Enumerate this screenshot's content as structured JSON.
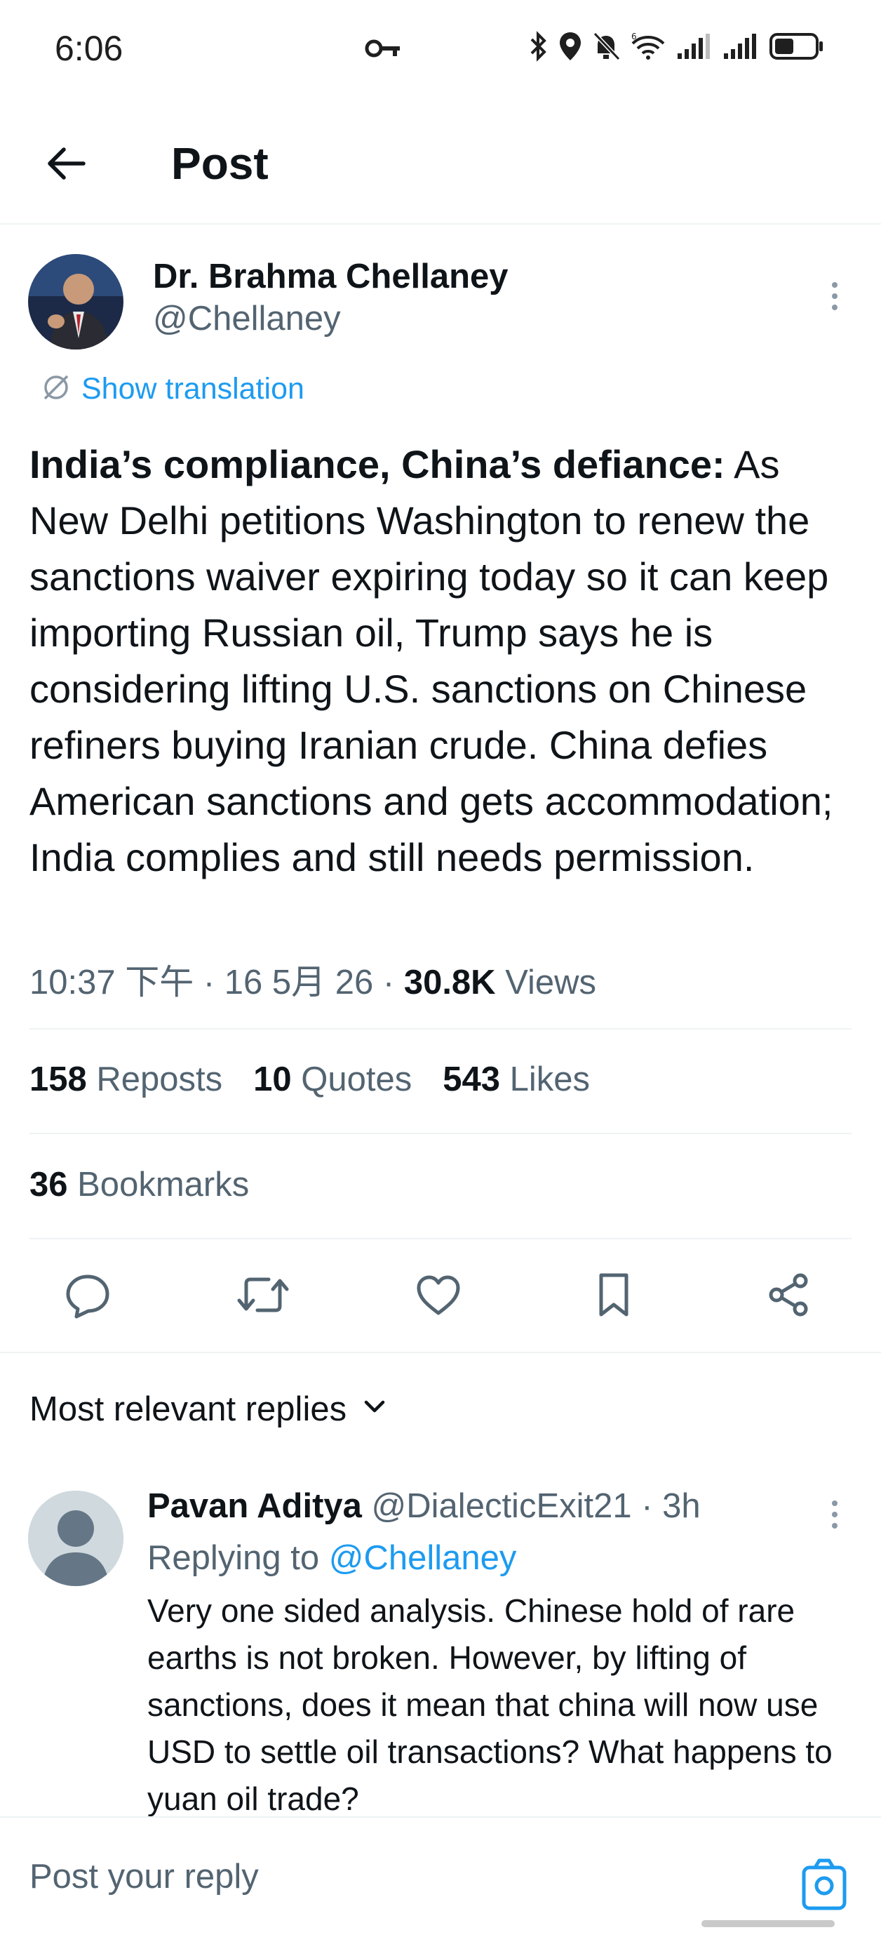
{
  "status_bar": {
    "time": "6:06",
    "icons": [
      "key-icon",
      "bluetooth-icon",
      "location-icon",
      "bell-off-icon",
      "wifi-6-icon",
      "signal-icon",
      "signal-icon",
      "battery-icon"
    ]
  },
  "header": {
    "title": "Post"
  },
  "post": {
    "author_name": "Dr. Brahma Chellaney",
    "author_handle": "@Chellaney",
    "show_translation": "Show translation",
    "headline": "India’s compliance, China’s defiance:",
    "body": " As New Delhi petitions Washington to renew the sanctions waiver expiring today so it can keep importing Russian oil, Trump says he is considering lifting U.S. sanctions on Chinese refiners buying Iranian crude. China defies American sanctions and gets accommodation; India complies and still needs permission.",
    "timestamp": "10:37 下午 · 16 5月 26 · ",
    "views_count": "30.8K",
    "views_label": " Views"
  },
  "stats": {
    "reposts_count": "158",
    "reposts_label": " Reposts",
    "quotes_count": "10",
    "quotes_label": " Quotes",
    "likes_count": "543",
    "likes_label": " Likes",
    "bookmarks_count": "36",
    "bookmarks_label": " Bookmarks"
  },
  "replies": {
    "heading": "Most relevant replies",
    "items": [
      {
        "name": "Pavan Aditya",
        "handle": " @DialecticExit21 · 3h",
        "replying_prefix": "Replying to ",
        "replying_to": "@Chellaney",
        "text": "Very one sided analysis. Chinese hold of rare earths is not broken. However, by lifting of sanctions, does it mean that china will now use USD to settle oil transactions? What happens to yuan oil trade?"
      }
    ]
  },
  "composer": {
    "placeholder": "Post your reply"
  },
  "colors": {
    "accent": "#1d9bf0",
    "text": "#0f1419",
    "secondary": "#536471",
    "divider": "#eff3f4"
  }
}
